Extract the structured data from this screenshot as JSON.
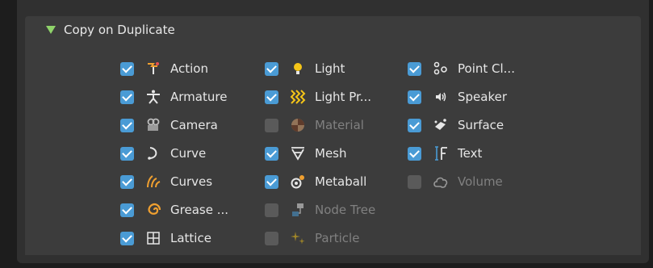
{
  "panel": {
    "title": "Copy on Duplicate"
  },
  "colors": {
    "checkbox_checked": "#4a9bd5",
    "checkbox_unchecked": "#5a5a5a",
    "header_arrow": "#8fd36a",
    "icon_orange": "#f0a030",
    "icon_yellow": "#f5c518"
  },
  "items": [
    {
      "label": "Action",
      "checked": true,
      "icon": "action-icon"
    },
    {
      "label": "Armature",
      "checked": true,
      "icon": "armature-icon"
    },
    {
      "label": "Camera",
      "checked": true,
      "icon": "camera-icon"
    },
    {
      "label": "Curve",
      "checked": true,
      "icon": "curve-icon"
    },
    {
      "label": "Curves",
      "checked": true,
      "icon": "curves-icon"
    },
    {
      "label": "Grease ...",
      "checked": true,
      "icon": "grease-pencil-icon"
    },
    {
      "label": "Lattice",
      "checked": true,
      "icon": "lattice-icon"
    },
    {
      "label": "Light",
      "checked": true,
      "icon": "light-icon"
    },
    {
      "label": "Light Pr...",
      "checked": true,
      "icon": "light-probe-icon"
    },
    {
      "label": "Material",
      "checked": false,
      "icon": "material-icon"
    },
    {
      "label": "Mesh",
      "checked": true,
      "icon": "mesh-icon"
    },
    {
      "label": "Metaball",
      "checked": true,
      "icon": "metaball-icon"
    },
    {
      "label": "Node Tree",
      "checked": false,
      "icon": "node-tree-icon"
    },
    {
      "label": "Particle",
      "checked": false,
      "icon": "particle-icon"
    },
    {
      "label": "Point Cl...",
      "checked": true,
      "icon": "point-cloud-icon"
    },
    {
      "label": "Speaker",
      "checked": true,
      "icon": "speaker-icon"
    },
    {
      "label": "Surface",
      "checked": true,
      "icon": "surface-icon"
    },
    {
      "label": "Text",
      "checked": true,
      "icon": "text-icon"
    },
    {
      "label": "Volume",
      "checked": false,
      "icon": "volume-icon"
    }
  ]
}
